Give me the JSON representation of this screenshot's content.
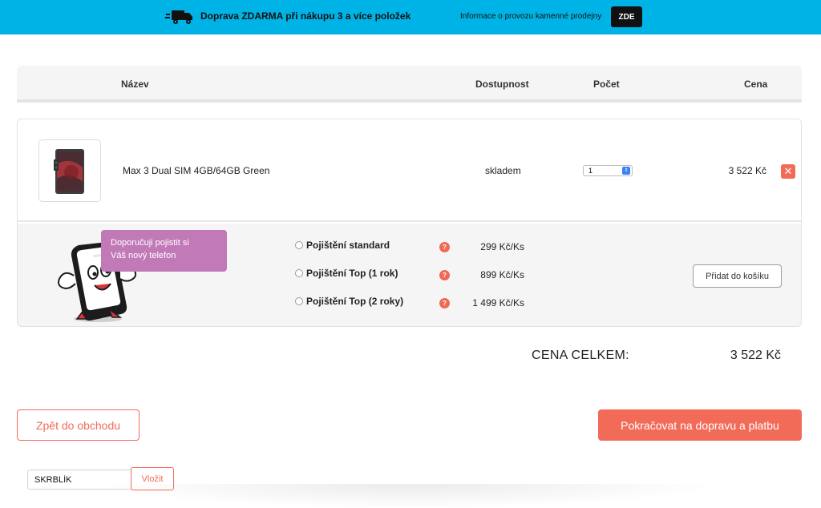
{
  "promo": {
    "text": "Doprava ZDARMA při nákupu 3 a více položek",
    "store_info": "Informace o provozu kamenné prodejny",
    "zde_label": "ZDE",
    "icon": "truck-icon"
  },
  "table": {
    "headers": [
      "Název",
      "Dostupnost",
      "Počet",
      "Cena"
    ]
  },
  "product": {
    "name": "Max 3 Dual SIM 4GB/64GB Green",
    "availability": "skladem",
    "quantity": "1",
    "price": "3 522 Kč"
  },
  "insurance": {
    "bubble_line1": "Doporučuji pojistit si",
    "bubble_line2": "Váš nový telefon",
    "options": [
      {
        "label": "Pojištění standard",
        "price": "299 Kč/Ks"
      },
      {
        "label": "Pojištění Top (1 rok)",
        "price": "899 Kč/Ks"
      },
      {
        "label": "Pojištění Top (2 roky)",
        "price": "1 499 Kč/Ks"
      }
    ],
    "help_glyph": "?",
    "add_label": "Přidat do košíku"
  },
  "totals": {
    "label": "CENA CELKEM:",
    "value": "3 522 Kč"
  },
  "actions": {
    "back_label": "Zpět do obchodu",
    "continue_label": "Pokračovat na dopravu a platbu"
  },
  "coupon": {
    "value": "SKRBLÍK",
    "button_label": "Vložit"
  },
  "colors": {
    "promo_bg": "#00b3e6",
    "accent": "#f26b58",
    "bubble": "#c179b8"
  }
}
